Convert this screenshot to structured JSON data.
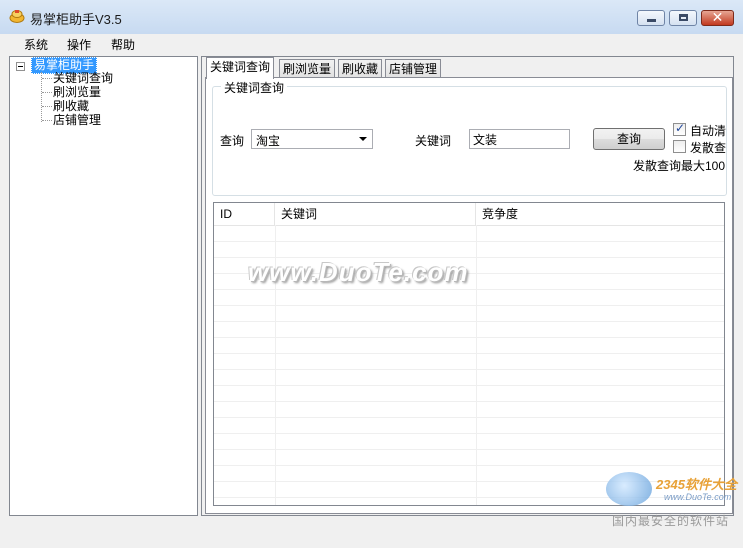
{
  "window": {
    "title": "易掌柜助手V3.5",
    "close_glyph": "✕"
  },
  "menu": [
    "系统",
    "操作",
    "帮助"
  ],
  "tree": {
    "root": "易掌柜助手",
    "children": [
      "关键词查询",
      "刷浏览量",
      "刷收藏",
      "店铺管理"
    ]
  },
  "tabs": [
    "关键词查询",
    "刷浏览量",
    "刷收藏",
    "店铺管理"
  ],
  "query_group": {
    "title": "关键词查询",
    "source_label": "查询",
    "source_value": "淘宝",
    "keyword_label": "关键词",
    "keyword_value": "文装",
    "query_button": "查询",
    "auto_clear_label": "自动清",
    "auto_clear_checked": true,
    "scatter_label": "发散查",
    "scatter_checked": false,
    "scatter_note": "发散查询最大100"
  },
  "results_table": {
    "columns": [
      "ID",
      "关键词",
      "竞争度"
    ],
    "rows": []
  },
  "watermark": {
    "text": "www.DuoTe.com",
    "brand": "2345软件大全",
    "url": "www.DuoTe.com",
    "slogan": "国内最安全的软件站"
  },
  "colors": {
    "titlebar": "#c7daf1",
    "selection": "#3399ff",
    "close_button": "#c2391f"
  }
}
